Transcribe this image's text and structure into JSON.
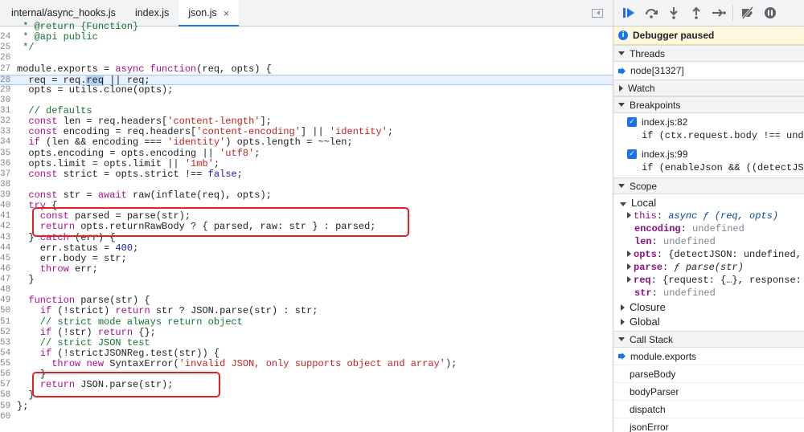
{
  "editor": {
    "tabs": [
      {
        "label": "internal/async_hooks.js"
      },
      {
        "label": "index.js"
      },
      {
        "label": "json.js",
        "close": "×"
      }
    ]
  },
  "code_lines": [
    {
      "n": "",
      "text": " * @return {Function}"
    },
    {
      "n": "24",
      "text": " * @api public"
    },
    {
      "n": "25",
      "text": " */"
    },
    {
      "n": "26",
      "text": ""
    },
    {
      "n": "27",
      "text": "module.exports = async function(req, opts) {"
    },
    {
      "n": "28",
      "text": "  req = req.req || req;"
    },
    {
      "n": "29",
      "text": "  opts = utils.clone(opts);"
    },
    {
      "n": "30",
      "text": ""
    },
    {
      "n": "31",
      "text": "  // defaults"
    },
    {
      "n": "32",
      "text": "  const len = req.headers['content-length'];"
    },
    {
      "n": "33",
      "text": "  const encoding = req.headers['content-encoding'] || 'identity';"
    },
    {
      "n": "34",
      "text": "  if (len && encoding === 'identity') opts.length = ~~len;"
    },
    {
      "n": "35",
      "text": "  opts.encoding = opts.encoding || 'utf8';"
    },
    {
      "n": "36",
      "text": "  opts.limit = opts.limit || '1mb';"
    },
    {
      "n": "37",
      "text": "  const strict = opts.strict !== false;"
    },
    {
      "n": "38",
      "text": ""
    },
    {
      "n": "39",
      "text": "  const str = await raw(inflate(req), opts);"
    },
    {
      "n": "40",
      "text": "  try {"
    },
    {
      "n": "41",
      "text": "    const parsed = parse(str);"
    },
    {
      "n": "42",
      "text": "    return opts.returnRawBody ? { parsed, raw: str } : parsed;"
    },
    {
      "n": "43",
      "text": "  } catch (err) {"
    },
    {
      "n": "44",
      "text": "    err.status = 400;"
    },
    {
      "n": "45",
      "text": "    err.body = str;"
    },
    {
      "n": "46",
      "text": "    throw err;"
    },
    {
      "n": "47",
      "text": "  }"
    },
    {
      "n": "48",
      "text": ""
    },
    {
      "n": "49",
      "text": "  function parse(str) {"
    },
    {
      "n": "50",
      "text": "    if (!strict) return str ? JSON.parse(str) : str;"
    },
    {
      "n": "51",
      "text": "    // strict mode always return object"
    },
    {
      "n": "52",
      "text": "    if (!str) return {};"
    },
    {
      "n": "53",
      "text": "    // strict JSON test"
    },
    {
      "n": "54",
      "text": "    if (!strictJSONReg.test(str)) {"
    },
    {
      "n": "55",
      "text": "      throw new SyntaxError('invalid JSON, only supports object and array');"
    },
    {
      "n": "56",
      "text": "    }"
    },
    {
      "n": "57",
      "text": "    return JSON.parse(str);"
    },
    {
      "n": "58",
      "text": "  }"
    },
    {
      "n": "59",
      "text": "};"
    },
    {
      "n": "60",
      "text": ""
    }
  ],
  "debugger": {
    "paused_label": "Debugger paused",
    "threads_label": "Threads",
    "thread_name": "node[31327]",
    "watch_label": "Watch",
    "breakpoints_label": "Breakpoints",
    "breakpoints": [
      {
        "file": "index.js:82",
        "code": "if (ctx.request.body !== und"
      },
      {
        "file": "index.js:99",
        "code": "if (enableJson && ((detectJS"
      }
    ],
    "scope_label": "Scope",
    "local_label": "Local",
    "scope": {
      "this_key": "this",
      "this_val": "async ƒ (req, opts)",
      "encoding_key": "encoding",
      "encoding_val": "undefined",
      "len_key": "len",
      "len_val": "undefined",
      "opts_key": "opts",
      "opts_val": "{detectJSON: undefined,",
      "parse_key": "parse",
      "parse_val": "ƒ parse(str)",
      "req_key": "req",
      "req_val": "{request: {…}, response:",
      "str_key": "str",
      "str_val": "undefined"
    },
    "closure_label": "Closure",
    "global_label": "Global",
    "callstack_label": "Call Stack",
    "callstack": [
      {
        "name": "module.exports"
      },
      {
        "name": "parseBody"
      },
      {
        "name": "bodyParser"
      },
      {
        "name": "dispatch"
      },
      {
        "name": "jsonError"
      }
    ]
  },
  "colors": {
    "accent": "#1a73e8",
    "highlight_box": "#e8201f",
    "paused_bg": "#fef7e0"
  }
}
